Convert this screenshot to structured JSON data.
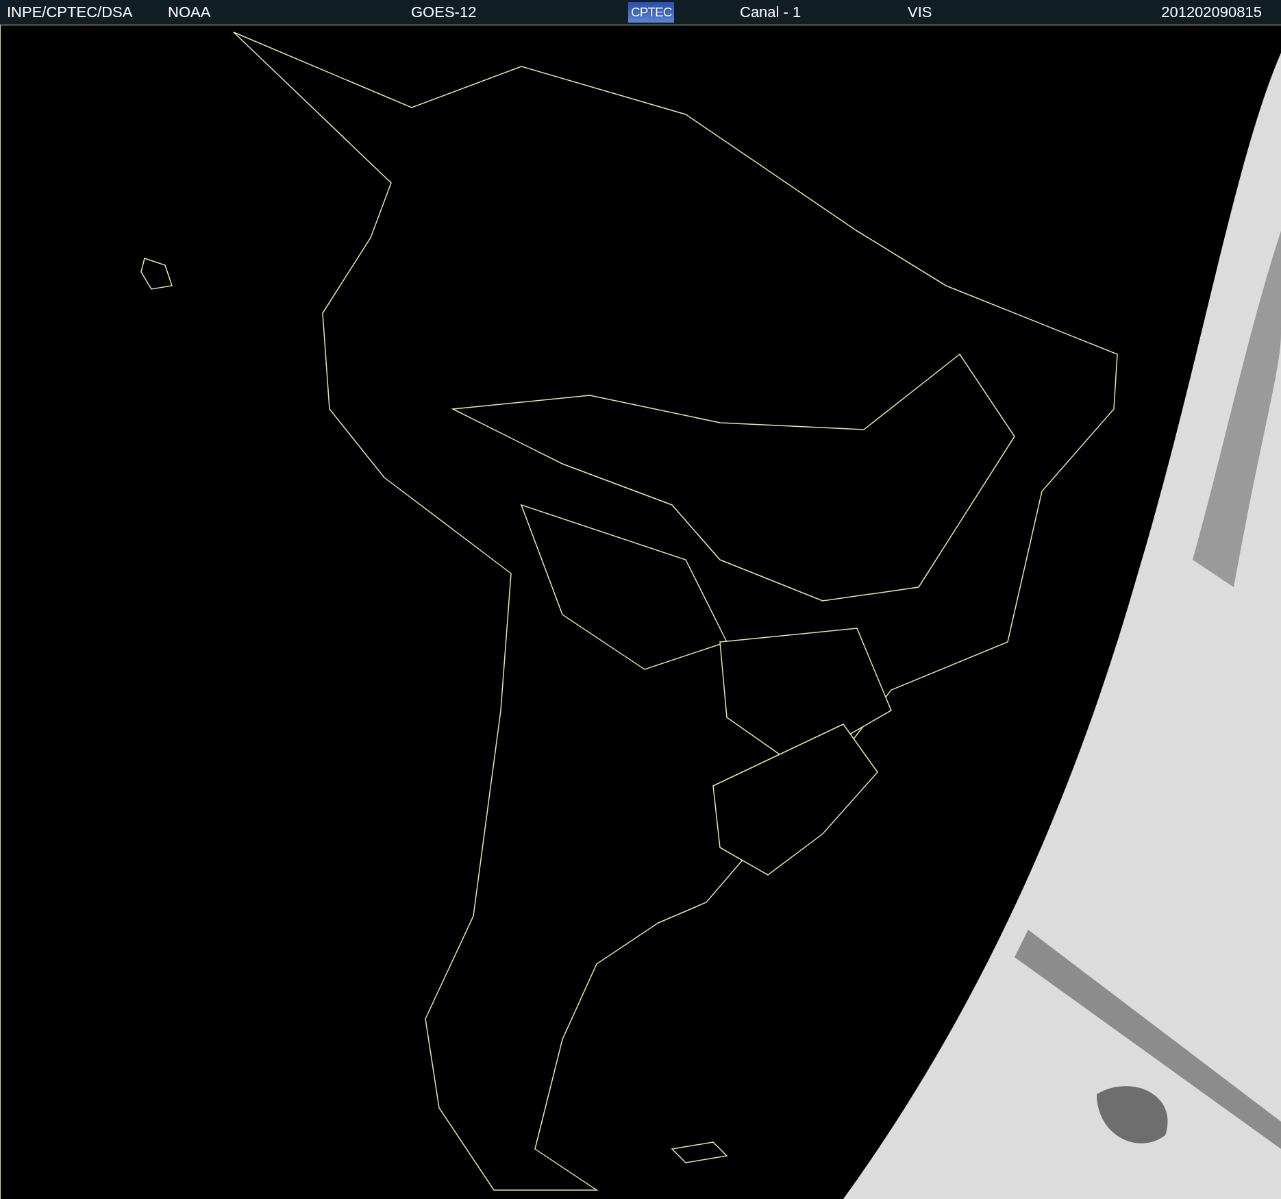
{
  "header": {
    "items": [
      {
        "kind": "text",
        "text": "INPE/CPTEC/DSA"
      },
      {
        "kind": "text",
        "text": "NOAA"
      },
      {
        "kind": "text",
        "text": "GOES-12"
      },
      {
        "kind": "logo",
        "text": "CPTEC"
      },
      {
        "kind": "text",
        "text": "Canal - 1"
      },
      {
        "kind": "text",
        "text": "VIS"
      },
      {
        "kind": "text",
        "text": "201202090815"
      }
    ]
  }
}
